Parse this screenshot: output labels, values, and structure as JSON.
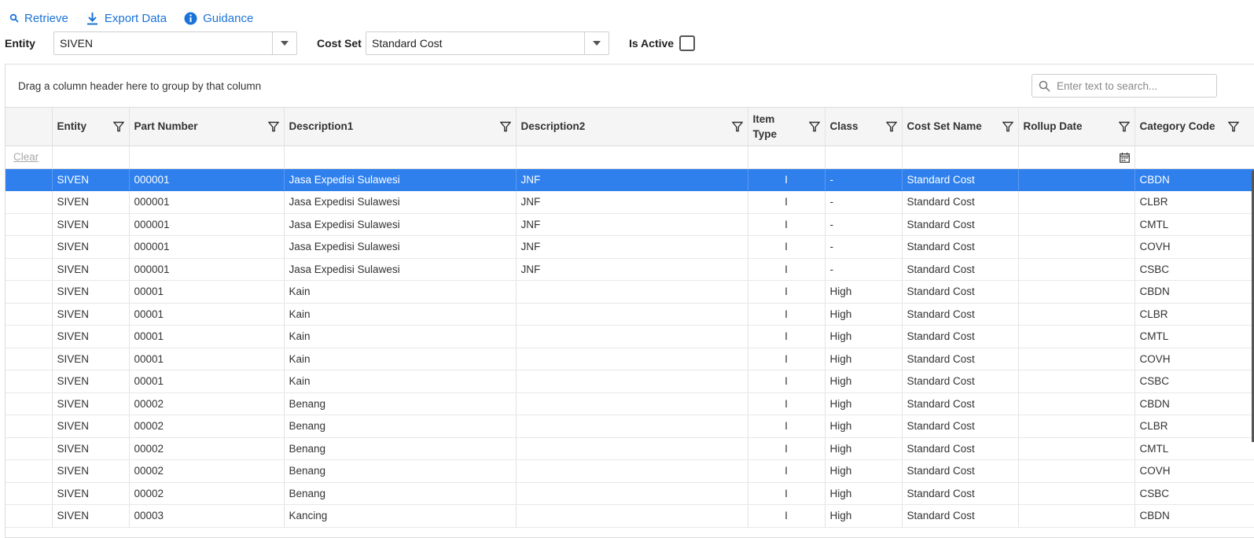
{
  "toolbar": {
    "retrieve": "Retrieve",
    "export": "Export Data",
    "guidance": "Guidance"
  },
  "filters": {
    "entity_label": "Entity",
    "entity_value": "SIVEN",
    "costset_label": "Cost Set",
    "costset_value": "Standard Cost",
    "isactive_label": "Is Active"
  },
  "grid": {
    "group_panel_text": "Drag a column header here to group by that column",
    "search_placeholder": "Enter text to search...",
    "clear_label": "Clear",
    "columns": [
      "Entity",
      "Part Number",
      "Description1",
      "Description2",
      "Item Type",
      "Class",
      "Cost Set Name",
      "Rollup Date",
      "Category Code"
    ],
    "rows": [
      {
        "entity": "SIVEN",
        "part": "000001",
        "desc1": "Jasa Expedisi Sulawesi",
        "desc2": "JNF",
        "type": "I",
        "class": "-",
        "costset": "Standard Cost",
        "rollup": "",
        "cat": "CBDN",
        "selected": true
      },
      {
        "entity": "SIVEN",
        "part": "000001",
        "desc1": "Jasa Expedisi Sulawesi",
        "desc2": "JNF",
        "type": "I",
        "class": "-",
        "costset": "Standard Cost",
        "rollup": "",
        "cat": "CLBR"
      },
      {
        "entity": "SIVEN",
        "part": "000001",
        "desc1": "Jasa Expedisi Sulawesi",
        "desc2": "JNF",
        "type": "I",
        "class": "-",
        "costset": "Standard Cost",
        "rollup": "",
        "cat": "CMTL"
      },
      {
        "entity": "SIVEN",
        "part": "000001",
        "desc1": "Jasa Expedisi Sulawesi",
        "desc2": "JNF",
        "type": "I",
        "class": "-",
        "costset": "Standard Cost",
        "rollup": "",
        "cat": "COVH"
      },
      {
        "entity": "SIVEN",
        "part": "000001",
        "desc1": "Jasa Expedisi Sulawesi",
        "desc2": "JNF",
        "type": "I",
        "class": "-",
        "costset": "Standard Cost",
        "rollup": "",
        "cat": "CSBC"
      },
      {
        "entity": "SIVEN",
        "part": "00001",
        "desc1": "Kain",
        "desc2": "",
        "type": "I",
        "class": "High",
        "costset": "Standard Cost",
        "rollup": "",
        "cat": "CBDN"
      },
      {
        "entity": "SIVEN",
        "part": "00001",
        "desc1": "Kain",
        "desc2": "",
        "type": "I",
        "class": "High",
        "costset": "Standard Cost",
        "rollup": "",
        "cat": "CLBR"
      },
      {
        "entity": "SIVEN",
        "part": "00001",
        "desc1": "Kain",
        "desc2": "",
        "type": "I",
        "class": "High",
        "costset": "Standard Cost",
        "rollup": "",
        "cat": "CMTL"
      },
      {
        "entity": "SIVEN",
        "part": "00001",
        "desc1": "Kain",
        "desc2": "",
        "type": "I",
        "class": "High",
        "costset": "Standard Cost",
        "rollup": "",
        "cat": "COVH"
      },
      {
        "entity": "SIVEN",
        "part": "00001",
        "desc1": "Kain",
        "desc2": "",
        "type": "I",
        "class": "High",
        "costset": "Standard Cost",
        "rollup": "",
        "cat": "CSBC"
      },
      {
        "entity": "SIVEN",
        "part": "00002",
        "desc1": "Benang",
        "desc2": "",
        "type": "I",
        "class": "High",
        "costset": "Standard Cost",
        "rollup": "",
        "cat": "CBDN"
      },
      {
        "entity": "SIVEN",
        "part": "00002",
        "desc1": "Benang",
        "desc2": "",
        "type": "I",
        "class": "High",
        "costset": "Standard Cost",
        "rollup": "",
        "cat": "CLBR"
      },
      {
        "entity": "SIVEN",
        "part": "00002",
        "desc1": "Benang",
        "desc2": "",
        "type": "I",
        "class": "High",
        "costset": "Standard Cost",
        "rollup": "",
        "cat": "CMTL"
      },
      {
        "entity": "SIVEN",
        "part": "00002",
        "desc1": "Benang",
        "desc2": "",
        "type": "I",
        "class": "High",
        "costset": "Standard Cost",
        "rollup": "",
        "cat": "COVH"
      },
      {
        "entity": "SIVEN",
        "part": "00002",
        "desc1": "Benang",
        "desc2": "",
        "type": "I",
        "class": "High",
        "costset": "Standard Cost",
        "rollup": "",
        "cat": "CSBC"
      },
      {
        "entity": "SIVEN",
        "part": "00003",
        "desc1": "Kancing",
        "desc2": "",
        "type": "I",
        "class": "High",
        "costset": "Standard Cost",
        "rollup": "",
        "cat": "CBDN"
      }
    ]
  },
  "colors": {
    "accent": "#1a73d9",
    "selection": "#2f80ed"
  },
  "icons": [
    "search-icon",
    "download-icon",
    "info-icon",
    "chevron-down-icon",
    "filter-icon",
    "calendar-icon"
  ]
}
